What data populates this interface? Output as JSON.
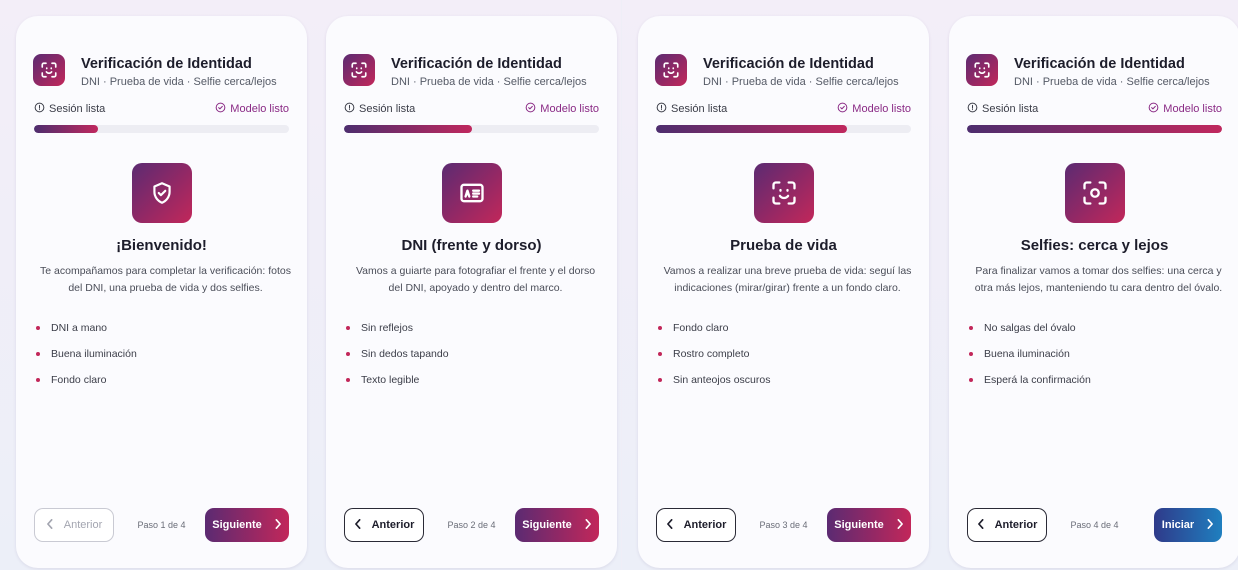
{
  "app": {
    "title": "Verificación de Identidad",
    "subtitle": "DNI · Prueba de vida · Selfie cerca/lejos",
    "status_session": "Sesión lista",
    "status_model": "Modelo listo",
    "prev_label": "Anterior",
    "next_label": "Siguiente",
    "start_label": "Iniciar"
  },
  "colors": {
    "accent_start": "#5b2a72",
    "accent_end": "#c2275a",
    "start_button_start": "#2f3a8a",
    "start_button_end": "#1f7fbf",
    "model_ready": "#8a2a85"
  },
  "steps": [
    {
      "icon": "shield-check-icon",
      "title": "¡Bienvenido!",
      "description": "Te acompañamos para completar la verificación: fotos del DNI, una prueba de vida y dos selfies.",
      "bullets": [
        "DNI a mano",
        "Buena iluminación",
        "Fondo claro"
      ],
      "step_label": "Paso 1 de 4",
      "progress": 0.25
    },
    {
      "icon": "id-card-icon",
      "title": "DNI (frente y dorso)",
      "description": "Vamos a guiarte para fotografiar el frente y el dorso del DNI, apoyado y dentro del marco.",
      "bullets": [
        "Sin reflejos",
        "Sin dedos tapando",
        "Texto legible"
      ],
      "step_label": "Paso 2 de 4",
      "progress": 0.5
    },
    {
      "icon": "face-scan-icon",
      "title": "Prueba de vida",
      "description": "Vamos a realizar una breve prueba de vida: seguí las indicaciones (mirar/girar) frente a un fondo claro.",
      "bullets": [
        "Fondo claro",
        "Rostro completo",
        "Sin anteojos oscuros"
      ],
      "step_label": "Paso 3 de 4",
      "progress": 0.75
    },
    {
      "icon": "camera-focus-icon",
      "title": "Selfies: cerca y lejos",
      "description": "Para finalizar vamos a tomar dos selfies: una cerca y otra más lejos, manteniendo tu cara dentro del óvalo.",
      "bullets": [
        "No salgas del óvalo",
        "Buena iluminación",
        "Esperá la confirmación"
      ],
      "step_label": "Paso 4 de 4",
      "progress": 1.0
    }
  ]
}
